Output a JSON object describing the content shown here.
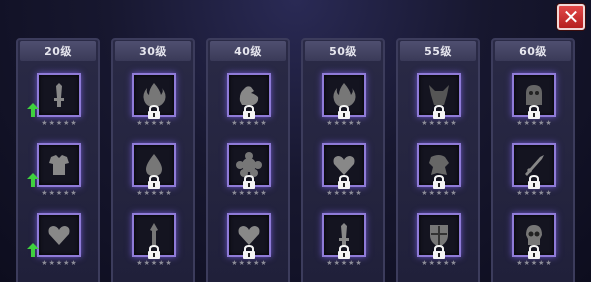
{
  "close_button": {
    "icon": "close-icon",
    "color": "#d43434"
  },
  "columns": [
    {
      "level": "20级",
      "slots": [
        {
          "icon": "sword-icon",
          "locked": false,
          "upgrade": true
        },
        {
          "icon": "armor-icon",
          "locked": false,
          "upgrade": true
        },
        {
          "icon": "heart-icon",
          "locked": false,
          "upgrade": true
        }
      ]
    },
    {
      "level": "30级",
      "slots": [
        {
          "icon": "flame-icon",
          "locked": true,
          "upgrade": false
        },
        {
          "icon": "drop-icon",
          "locked": true,
          "upgrade": false
        },
        {
          "icon": "spear-icon",
          "locked": true,
          "upgrade": false
        }
      ]
    },
    {
      "level": "40级",
      "slots": [
        {
          "icon": "muscle-icon",
          "locked": true,
          "upgrade": false
        },
        {
          "icon": "gear-icon",
          "locked": true,
          "upgrade": false
        },
        {
          "icon": "heart-icon",
          "locked": true,
          "upgrade": false
        }
      ]
    },
    {
      "level": "50级",
      "slots": [
        {
          "icon": "flame-icon",
          "locked": true,
          "upgrade": false
        },
        {
          "icon": "heart-icon",
          "locked": true,
          "upgrade": false
        },
        {
          "icon": "sword-icon",
          "locked": true,
          "upgrade": false
        }
      ]
    },
    {
      "level": "55级",
      "slots": [
        {
          "icon": "demon-icon",
          "locked": true,
          "upgrade": false
        },
        {
          "icon": "beast-icon",
          "locked": true,
          "upgrade": false
        },
        {
          "icon": "shield-icon",
          "locked": true,
          "upgrade": false
        }
      ]
    },
    {
      "level": "60级",
      "slots": [
        {
          "icon": "ghost-icon",
          "locked": true,
          "upgrade": false
        },
        {
          "icon": "blade-icon",
          "locked": true,
          "upgrade": false
        },
        {
          "icon": "skull-icon",
          "locked": true,
          "upgrade": false
        }
      ]
    }
  ],
  "star_count": 5,
  "colors": {
    "frame_glow": "#8f7bd8",
    "upgrade_arrow": "#3fd13f",
    "header": "#4a4a6a"
  }
}
